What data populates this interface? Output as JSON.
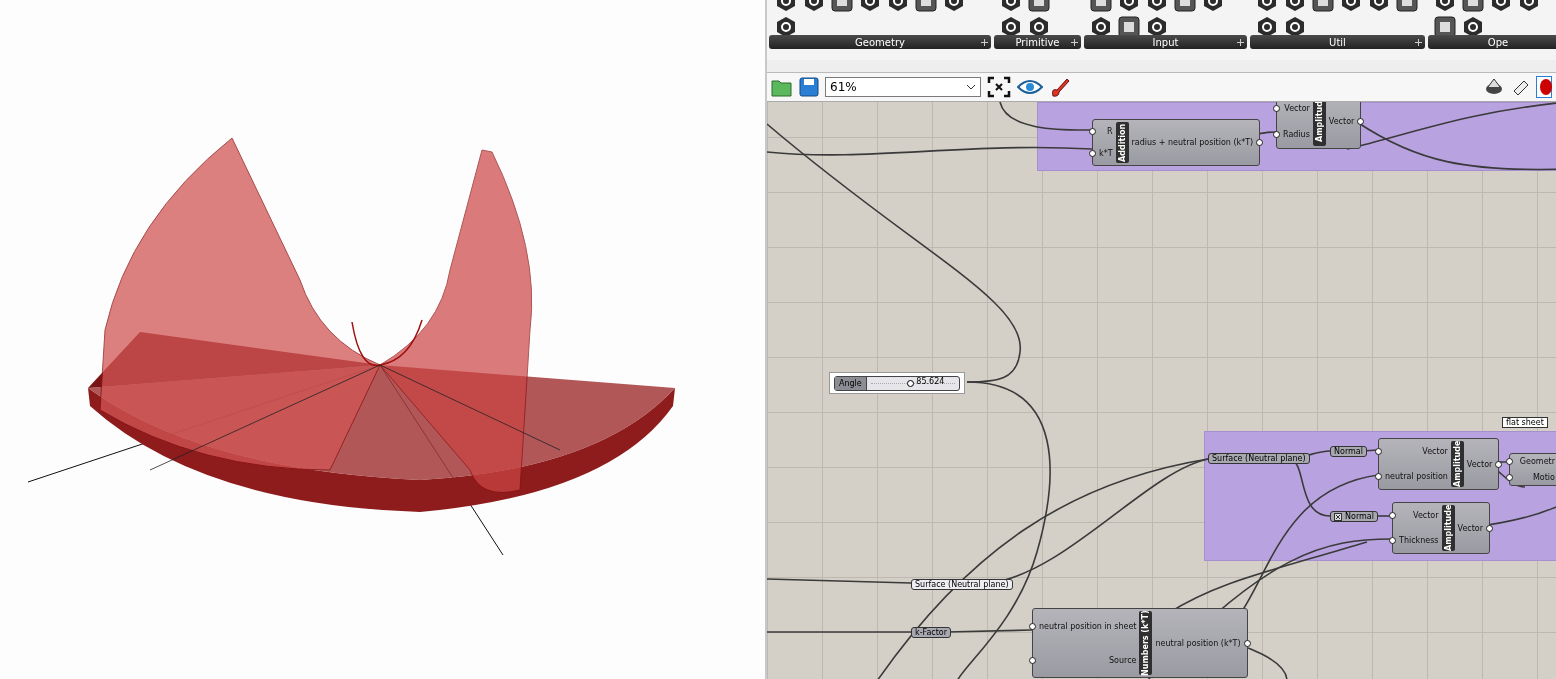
{
  "ribbon": {
    "groups": [
      {
        "label": "Geometry"
      },
      {
        "label": "Primitive"
      },
      {
        "label": "Input"
      },
      {
        "label": "Util"
      },
      {
        "label": "Ope"
      }
    ]
  },
  "canvas_toolbar": {
    "zoom": "61%"
  },
  "canvas": {
    "groups": [
      {
        "kind": "group"
      },
      {
        "kind": "group"
      }
    ],
    "nodes": [
      {
        "kind": "component",
        "title": "Amplitud",
        "inputs": [
          "Vector",
          "Radius"
        ],
        "outputs": [
          "Vector"
        ]
      },
      {
        "kind": "component",
        "title": "Addition",
        "inputs": [
          "R",
          "k*T"
        ],
        "outputs": [
          "radius + neutral position (k*T)"
        ]
      },
      {
        "kind": "slider",
        "label": "Angle",
        "value": "85.624",
        "level": 0.47
      },
      {
        "kind": "tooltip",
        "label": "flat sheet"
      },
      {
        "kind": "param",
        "label": "Normal"
      },
      {
        "kind": "param",
        "label": "Surface (Neutral plane)"
      },
      {
        "kind": "component",
        "title": "Amplitude",
        "inputs": [
          "Vector",
          "neutral position"
        ],
        "outputs": [
          "Vector"
        ]
      },
      {
        "kind": "component",
        "inputs": [
          "Geometr",
          "Motio"
        ]
      },
      {
        "kind": "iconparam",
        "label": "Normal"
      },
      {
        "kind": "component",
        "title": "Amplitude",
        "inputs": [
          "Vector",
          "Thickness"
        ],
        "outputs": [
          "Vector"
        ]
      },
      {
        "kind": "lightparam",
        "label": "Surface (Neutral plane)"
      },
      {
        "kind": "param",
        "label": "k-Factor"
      },
      {
        "kind": "component",
        "title": "Numbers (k*T)",
        "inputs": [
          "neutral position in sheet",
          "Source"
        ],
        "outputs": [
          "neutral position (k*T)"
        ]
      }
    ]
  }
}
